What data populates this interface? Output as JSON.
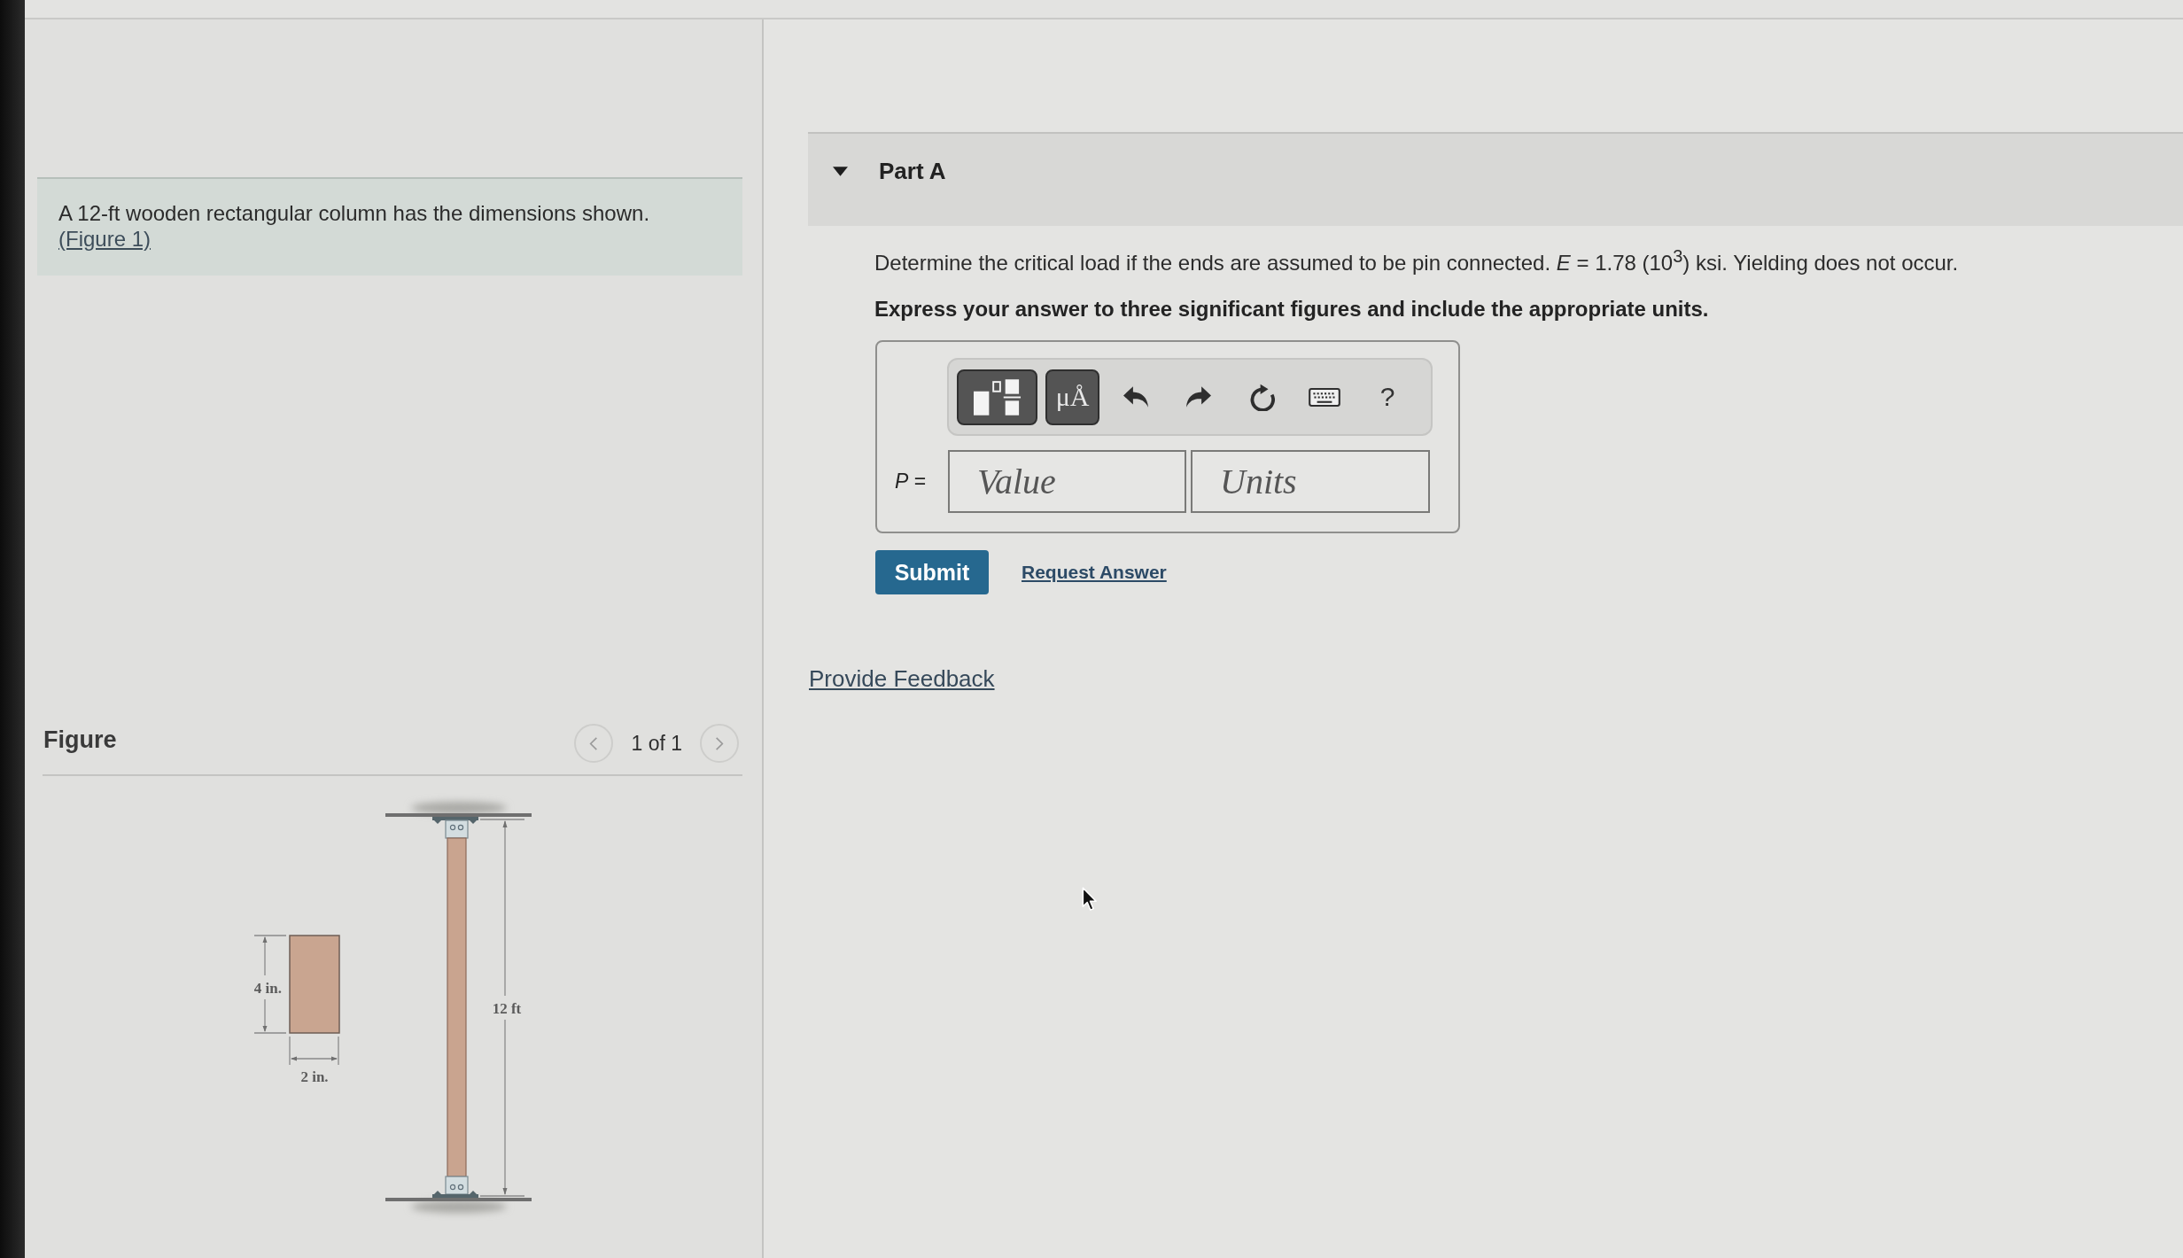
{
  "problem": {
    "statement": "A 12-ft wooden rectangular column has the dimensions shown.",
    "figure_link": "(Figure 1)"
  },
  "figure": {
    "title": "Figure",
    "pager": "1 of 1",
    "section_height": "4 in.",
    "section_width": "2 in.",
    "column_length": "12 ft"
  },
  "part": {
    "title": "Part A",
    "expanded": true,
    "question": "Determine the critical load if the ends are assumed to be pin connected. *E* = 1.78 (10$^{3}$) ksi. Yielding does not occur.",
    "instruction": "Express your answer to three significant figures and include the appropriate units.",
    "toolbar": [
      {
        "kind": "templates"
      },
      {
        "kind": "symbols",
        "label": "μÅ"
      },
      {
        "kind": "undo"
      },
      {
        "kind": "redo"
      },
      {
        "kind": "reset"
      },
      {
        "kind": "keyboard"
      },
      {
        "kind": "help",
        "label": "?"
      }
    ],
    "answer": {
      "variable": "*P* =",
      "value": {
        "placeholder": "Value"
      },
      "units": {
        "placeholder": "Units"
      }
    },
    "submit": "Submit",
    "request_answer": "Request Answer"
  },
  "feedback_link": "Provide Feedback"
}
